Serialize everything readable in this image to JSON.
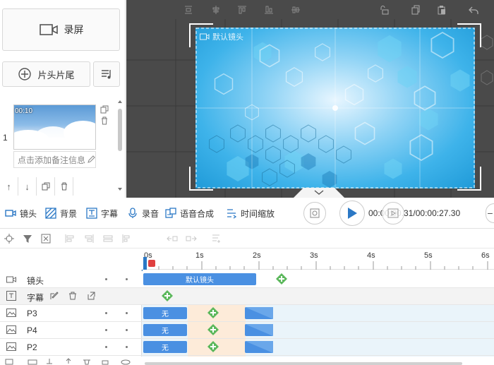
{
  "left_panel": {
    "record_label": "录屏",
    "titles_label": "片头片尾",
    "clip": {
      "number": "1",
      "duration": "00:10",
      "note_placeholder": "点击添加备注信息"
    }
  },
  "preview": {
    "camera_label": "默认镜头"
  },
  "tools": {
    "camera": "镜头",
    "background": "背景",
    "subtitle": "字幕",
    "audio": "录音",
    "tts": "语音合成",
    "time_zoom": "时间缩放"
  },
  "playback": {
    "timecode": "00:00:00.31/00:00:27.30"
  },
  "ruler": {
    "ticks": [
      "0s",
      "1s",
      "2s",
      "3s",
      "4s",
      "5s",
      "6s"
    ]
  },
  "tracks": [
    {
      "name": "镜头",
      "clip_label": "默认镜头"
    },
    {
      "name": "字幕"
    },
    {
      "name": "P3",
      "clip_label": "无"
    },
    {
      "name": "P4",
      "clip_label": "无"
    },
    {
      "name": "P2",
      "clip_label": "无"
    }
  ],
  "colors": {
    "accent": "#2b78c5",
    "clip_blue": "#4a90e2",
    "add_green": "#5cb85c",
    "preview_bg": "#4a4a4a",
    "playhead": "#e04040"
  }
}
